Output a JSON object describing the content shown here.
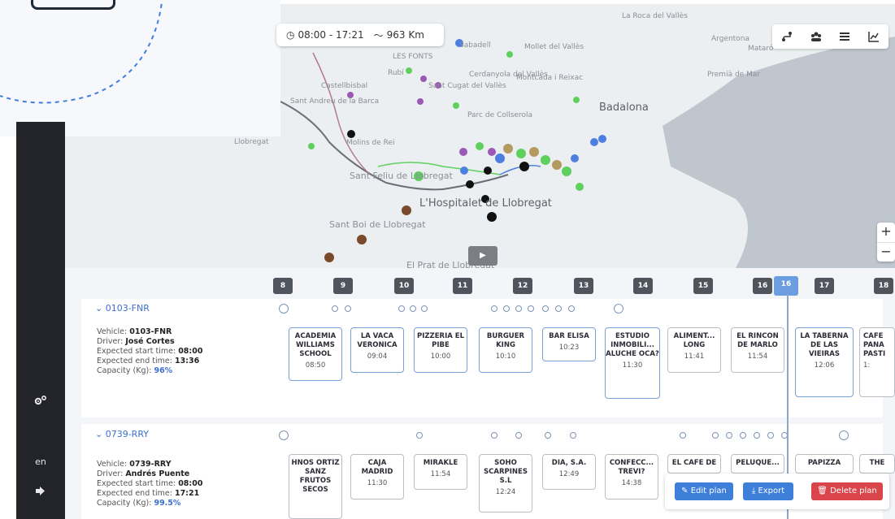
{
  "summary": {
    "clock_icon": "clock-icon",
    "time_range": "08:00 - 17:21",
    "route_icon": "route-icon",
    "distance": "963 Km"
  },
  "toolbar": {
    "icons": [
      "route-icon",
      "people-icon",
      "list-icon",
      "chart-icon"
    ]
  },
  "map": {
    "places": [
      "Sabadell",
      "LES FONTS",
      "Mollet del Vallès",
      "La Roca del Vallès",
      "Argentona",
      "Mataró",
      "Rubí",
      "Cerdanyola del Vallès",
      "Sant Cugat del Vallès",
      "Montcada i Reixac",
      "Premià de Mar",
      "Castellbisbal",
      "Sant Andreu de la Barca",
      "Parc de Collserola",
      "Badalona",
      "Llobregat",
      "Molins de Rei",
      "Sant Feliu de Llobregat",
      "L'Hospitalet de Llobregat",
      "Sant Boi de Llobregat",
      "El Prat de Llobregat"
    ],
    "zoom_in": "+",
    "zoom_out": "−",
    "play_icon": "play-icon"
  },
  "sidebar": {
    "settings_icon": "settings-icon",
    "language": "en",
    "logout_icon": "logout-icon"
  },
  "timeline": {
    "hours": [
      "8",
      "9",
      "10",
      "11",
      "12",
      "13",
      "14",
      "15",
      "16",
      "16",
      "17",
      "18"
    ],
    "current_hour": "16"
  },
  "vehicles": [
    {
      "id": "0103-FNR",
      "vehicle_label": "Vehicle:",
      "vehicle": "0103-FNR",
      "driver_label": "Driver:",
      "driver": "José Cortes",
      "start_label": "Expected start time:",
      "start": "08:00",
      "end_label": "Expected end time:",
      "end": "13:36",
      "capacity_label": "Capacity (Kg):",
      "capacity": "96%",
      "stops": [
        {
          "name": "ACADEMIA WILLIAMS SCHOOL",
          "time": "08:50"
        },
        {
          "name": "LA VACA VERONICA",
          "time": "09:04"
        },
        {
          "name": "PIZZERIA EL PIBE",
          "time": "10:00"
        },
        {
          "name": "BURGUER KING",
          "time": "10:10"
        },
        {
          "name": "BAR ELISA",
          "time": "10:23"
        },
        {
          "name": "ESTUDIO INMOBILI... ALUCHE OCA?",
          "time": "11:30"
        },
        {
          "name": "ALIMENT... LONG",
          "time": "11:41"
        },
        {
          "name": "EL RINCON DE MARLO",
          "time": "11:54"
        },
        {
          "name": "LA TABERNA DE LAS VIEIRAS",
          "time": "12:06"
        },
        {
          "name": "CAFE PANA PASTI",
          "time": "1:"
        }
      ]
    },
    {
      "id": "0739-RRY",
      "vehicle_label": "Vehicle:",
      "vehicle": "0739-RRY",
      "driver_label": "Driver:",
      "driver": "Andrés Puente",
      "start_label": "Expected start time:",
      "start": "08:00",
      "end_label": "Expected end time:",
      "end": "17:21",
      "capacity_label": "Capacity (Kg):",
      "capacity": "99.5%",
      "stops": [
        {
          "name": "HNOS ORTIZ SANZ FRUTOS SECOS",
          "time": ""
        },
        {
          "name": "CAJA MADRID",
          "time": "11:30"
        },
        {
          "name": "MIRAKLE",
          "time": "11:54"
        },
        {
          "name": "SOHO SCARPINES S.L",
          "time": "12:24"
        },
        {
          "name": "DIA, S.A.",
          "time": "12:49"
        },
        {
          "name": "CONFECC... TREVI?",
          "time": "14:38"
        },
        {
          "name": "EL CAFE DE",
          "time": ""
        },
        {
          "name": "PELUQUE...",
          "time": ""
        },
        {
          "name": "PAPIZZA",
          "time": ""
        },
        {
          "name": "THE",
          "time": ""
        }
      ]
    }
  ],
  "actions": {
    "edit_label": "Edit plan",
    "export_label": "Export",
    "delete_label": "Delete plan",
    "edit_icon": "pencil-icon",
    "export_icon": "download-icon",
    "delete_icon": "trash-icon"
  },
  "colors": {
    "primary": "#3d7fd9",
    "danger": "#d9454a",
    "sidebar": "#23232a",
    "marker_green": "#5ed05e",
    "marker_purple": "#9b59b6",
    "marker_black": "#111111",
    "marker_tan": "#b59a5f",
    "marker_blue": "#4d7fe0",
    "marker_brown": "#7a4a2a"
  }
}
